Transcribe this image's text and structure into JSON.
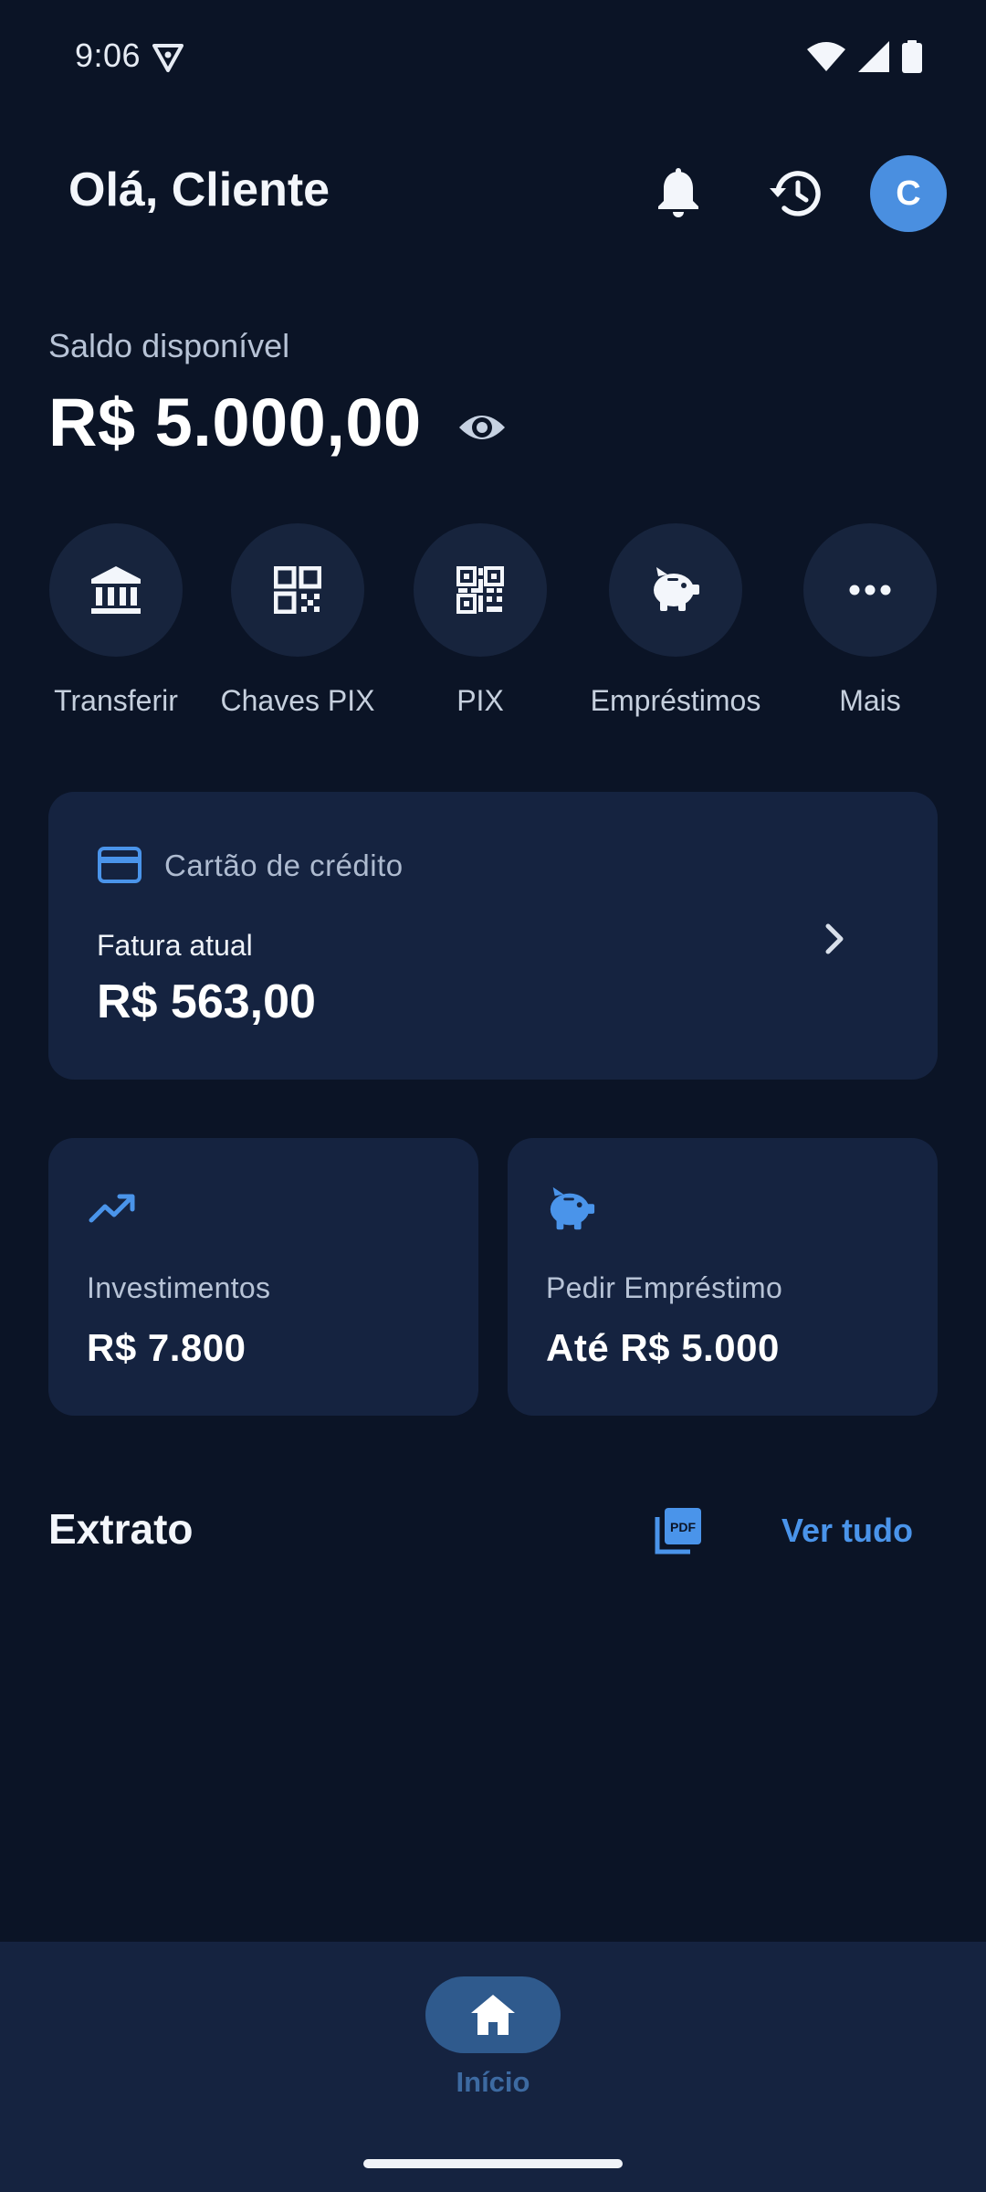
{
  "status_bar": {
    "time": "9:06",
    "icons": [
      "vpn-key-icon",
      "wifi-icon",
      "signal-icon",
      "battery-icon"
    ]
  },
  "header": {
    "greeting": "Olá, Cliente",
    "avatar_initial": "C",
    "icons": [
      "bell-icon",
      "history-icon"
    ]
  },
  "balance": {
    "label": "Saldo disponível",
    "value": "R$ 5.000,00",
    "toggle_icon": "eye-icon"
  },
  "quick_actions": [
    {
      "label": "Transferir",
      "icon": "bank-icon"
    },
    {
      "label": "Chaves PIX",
      "icon": "qr-code-icon"
    },
    {
      "label": "PIX",
      "icon": "qr-scan-icon"
    },
    {
      "label": "Empréstimos",
      "icon": "piggy-bank-icon"
    },
    {
      "label": "Mais",
      "icon": "more-dots-icon"
    }
  ],
  "credit_card": {
    "title": "Cartão de crédito",
    "subtitle": "Fatura atual",
    "amount": "R$ 563,00"
  },
  "cards": {
    "investments": {
      "label": "Investimentos",
      "value": "R$ 7.800",
      "icon": "trending-up-icon"
    },
    "loan": {
      "label": "Pedir Empréstimo",
      "value": "Até R$ 5.000",
      "icon": "piggy-bank-icon"
    }
  },
  "statement": {
    "title": "Extrato",
    "see_all": "Ver tudo",
    "pdf_icon": "pdf-icon"
  },
  "bottom_nav": {
    "items": [
      {
        "label": "Início",
        "icon": "home-icon",
        "active": true
      }
    ]
  },
  "colors": {
    "background": "#0b1426",
    "card": "#152340",
    "accent": "#4a94ea",
    "avatar": "#4a8fe0",
    "nav_active": "#2f5a8d"
  }
}
